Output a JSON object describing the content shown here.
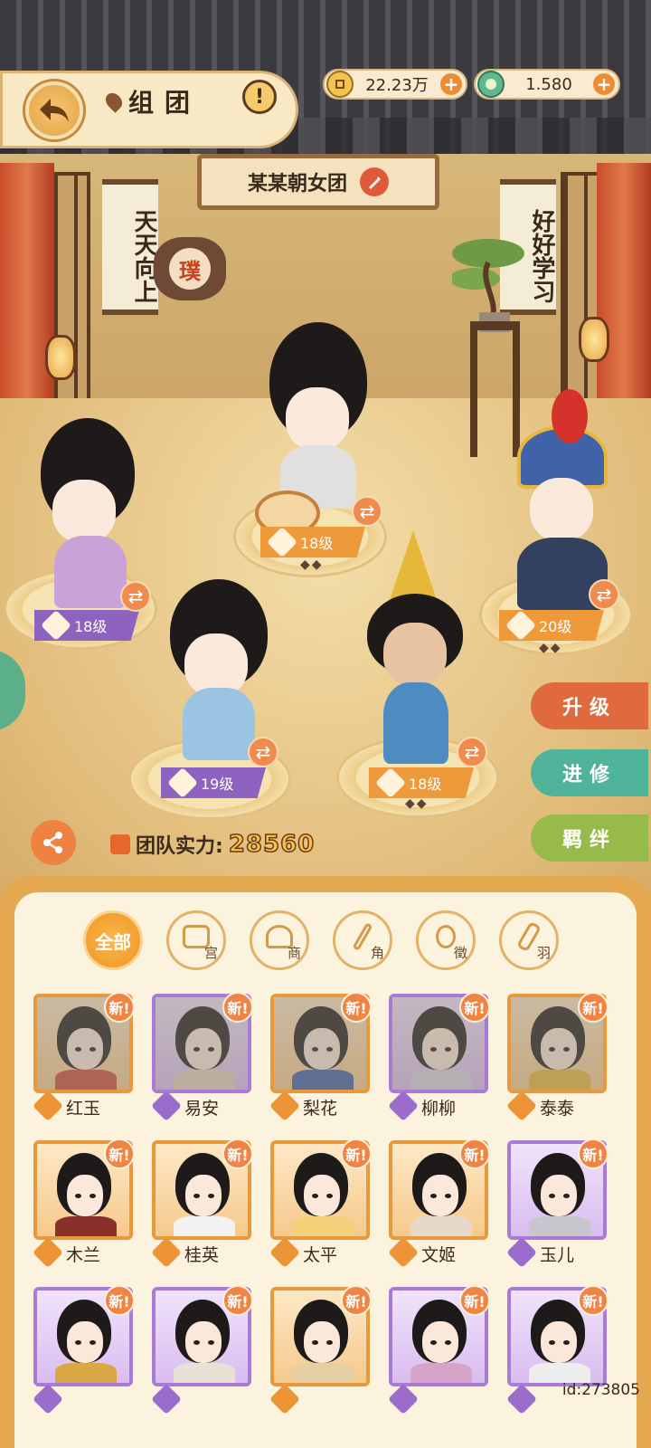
{
  "header": {
    "title": "组团",
    "gold": "22.23万",
    "jade": "1.580"
  },
  "scene": {
    "team_name": "某某朝女团",
    "scroll_left": "天天向上",
    "scroll_right": "好好学习",
    "seal_char": "璞"
  },
  "team_slots": [
    {
      "level": "18级",
      "color": "#8e63c0"
    },
    {
      "level": "18级",
      "color": "#ee9a3a"
    },
    {
      "level": "20级",
      "color": "#ee9a3a"
    },
    {
      "level": "19级",
      "color": "#8e63c0"
    },
    {
      "level": "18级",
      "color": "#ee9a3a"
    }
  ],
  "side_buttons": {
    "upgrade": "升级",
    "advance": "进修",
    "bond": "羁绊"
  },
  "power": {
    "label": "团队实力:",
    "value": "28560"
  },
  "filters": [
    "全部",
    "宫",
    "商",
    "角",
    "徵",
    "羽"
  ],
  "new_badge": "新!",
  "characters": [
    {
      "name": "红玉",
      "rarity": "orange",
      "dim": true
    },
    {
      "name": "易安",
      "rarity": "purple",
      "dim": true
    },
    {
      "name": "梨花",
      "rarity": "orange",
      "dim": true
    },
    {
      "name": "柳柳",
      "rarity": "purple",
      "dim": true
    },
    {
      "name": "泰泰",
      "rarity": "orange",
      "dim": true
    },
    {
      "name": "木兰",
      "rarity": "orange",
      "dim": false
    },
    {
      "name": "桂英",
      "rarity": "orange",
      "dim": false
    },
    {
      "name": "太平",
      "rarity": "orange",
      "dim": false
    },
    {
      "name": "文姬",
      "rarity": "orange",
      "dim": false
    },
    {
      "name": "玉儿",
      "rarity": "purple",
      "dim": false
    },
    {
      "name": "",
      "rarity": "purple",
      "dim": false
    },
    {
      "name": "",
      "rarity": "purple",
      "dim": false
    },
    {
      "name": "",
      "rarity": "orange",
      "dim": false
    },
    {
      "name": "",
      "rarity": "purple",
      "dim": false
    },
    {
      "name": "",
      "rarity": "purple",
      "dim": false
    }
  ],
  "footer": {
    "uid": "id:273805"
  },
  "colors": {
    "accent": "#ee8c33",
    "upgrade": "#df6a3e",
    "advance": "#4fb49a",
    "bond": "#98ba4a"
  }
}
